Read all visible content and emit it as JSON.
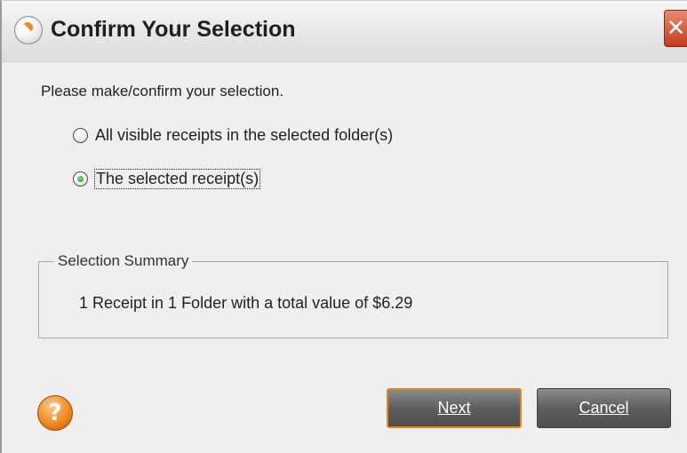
{
  "window": {
    "title": "Confirm Your Selection",
    "close_glyph": "✕"
  },
  "prompt": "Please make/confirm your selection.",
  "options": [
    {
      "label": "All visible receipts in the selected folder(s)",
      "selected": false
    },
    {
      "label": "The selected receipt(s)",
      "selected": true
    }
  ],
  "summary": {
    "legend": "Selection Summary",
    "text": "1 Receipt in 1 Folder with a total value of $6.29"
  },
  "buttons": {
    "help_glyph": "?",
    "next_label": "Next",
    "cancel_label": "Cancel"
  },
  "colors": {
    "accent_border": "#e08a1e",
    "close_red": "#c23c1b",
    "radio_green": "#2d9b2a"
  },
  "icons": {
    "app": "app-logo-icon",
    "close": "close-icon",
    "help": "help-icon"
  }
}
